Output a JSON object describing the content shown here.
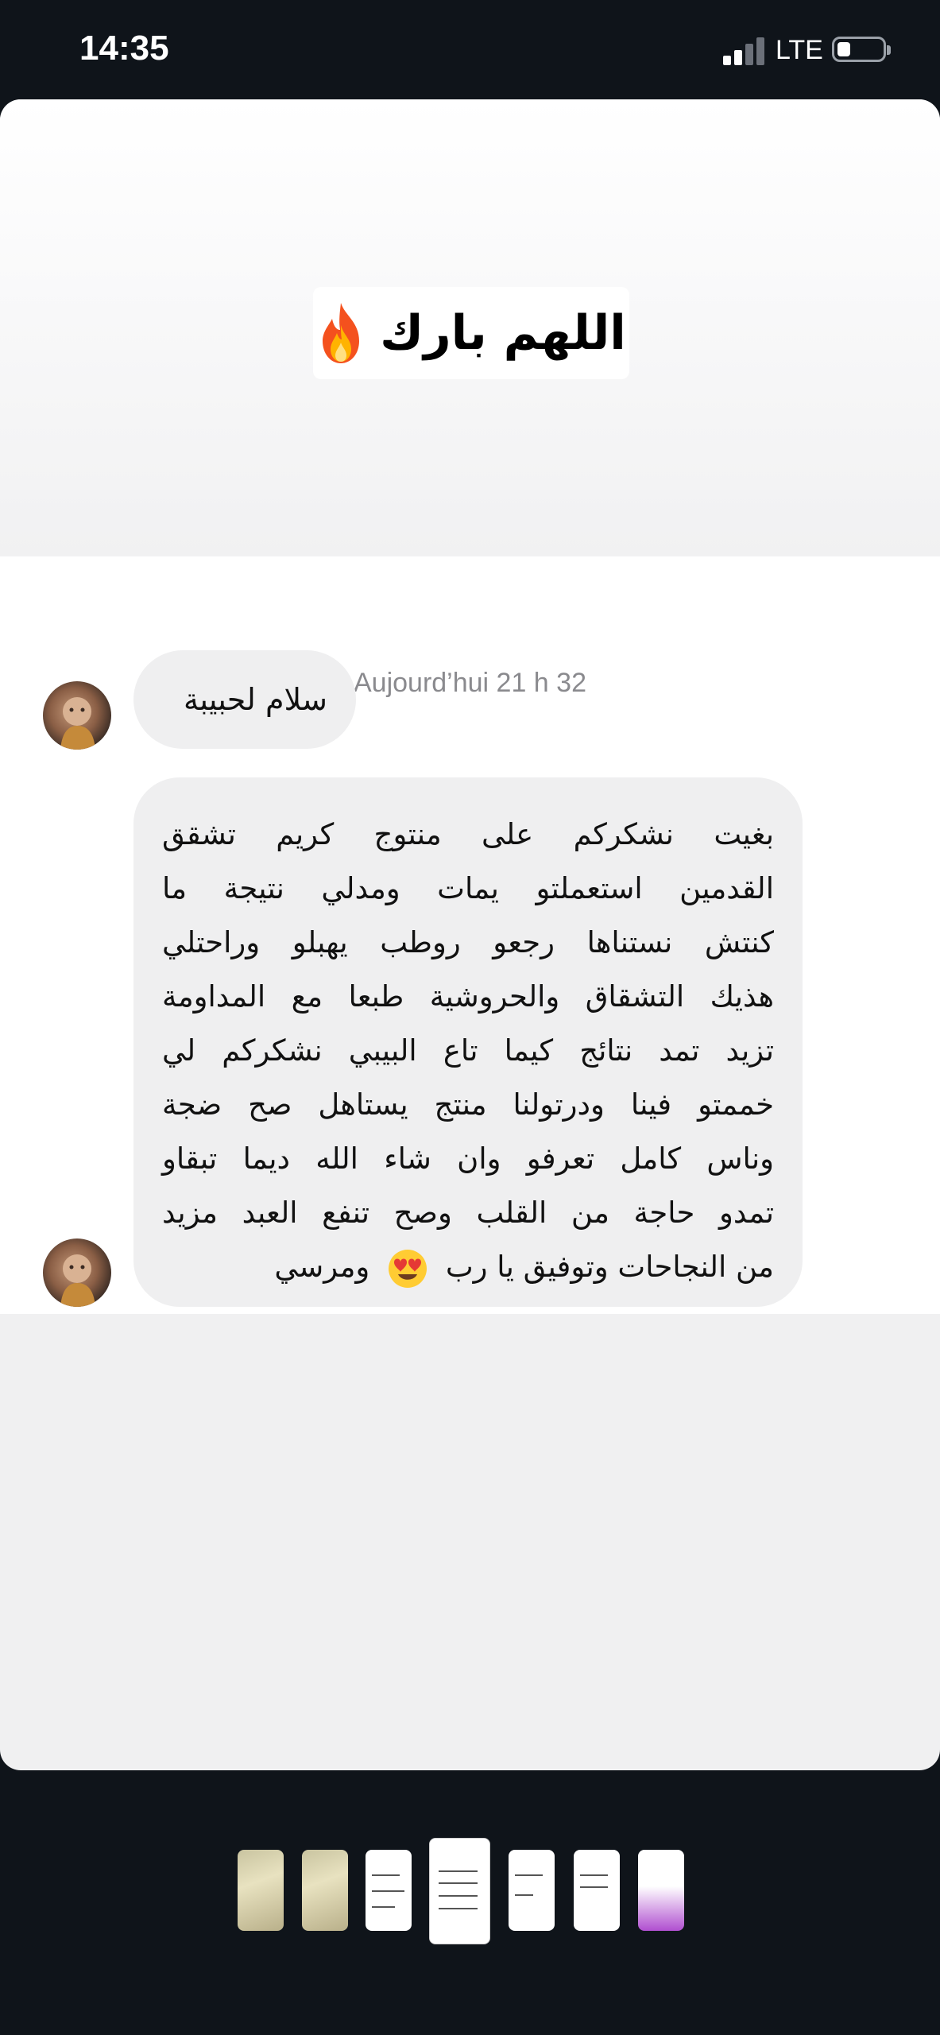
{
  "status_bar": {
    "time": "14:35",
    "network": "LTE",
    "signal_bars": 2,
    "signal_bars_total": 4,
    "battery_level": 0.2
  },
  "story": {
    "sticker_text": "اللهم بارك",
    "sticker_icon": "fire-icon"
  },
  "chat": {
    "timestamp": "Aujourd’hui 21 h 32",
    "messages": [
      {
        "lines": [
          "سلام لحبيبة"
        ]
      },
      {
        "lines": [
          "بغيت نشكركم على منتوج كريم تشقق",
          "القدمين استعملتو يمات ومدلي نتيجة ما",
          "كنتش نستناها رجعو روطب يهبلو وراحتلي",
          "هذيك التشقاق والحروشية طبعا مع المداومة",
          "تزيد تمد نتائج كيما تاع البيبي نشكركم لي",
          "خممتو فينا ودرتولنا منتج يستاهل صح ضجة",
          "وناس كامل تعرفو وان شاء الله ديما تبقاو",
          "تمدو حاجة من القلب وصح تنفع العبد مزيد",
          "من النجاحات وتوفيق يا رب",
          "ومرسي"
        ],
        "emoji": "heart-eyes-emoji"
      }
    ]
  },
  "thumbnails": {
    "count": 7,
    "active_index": 3
  }
}
